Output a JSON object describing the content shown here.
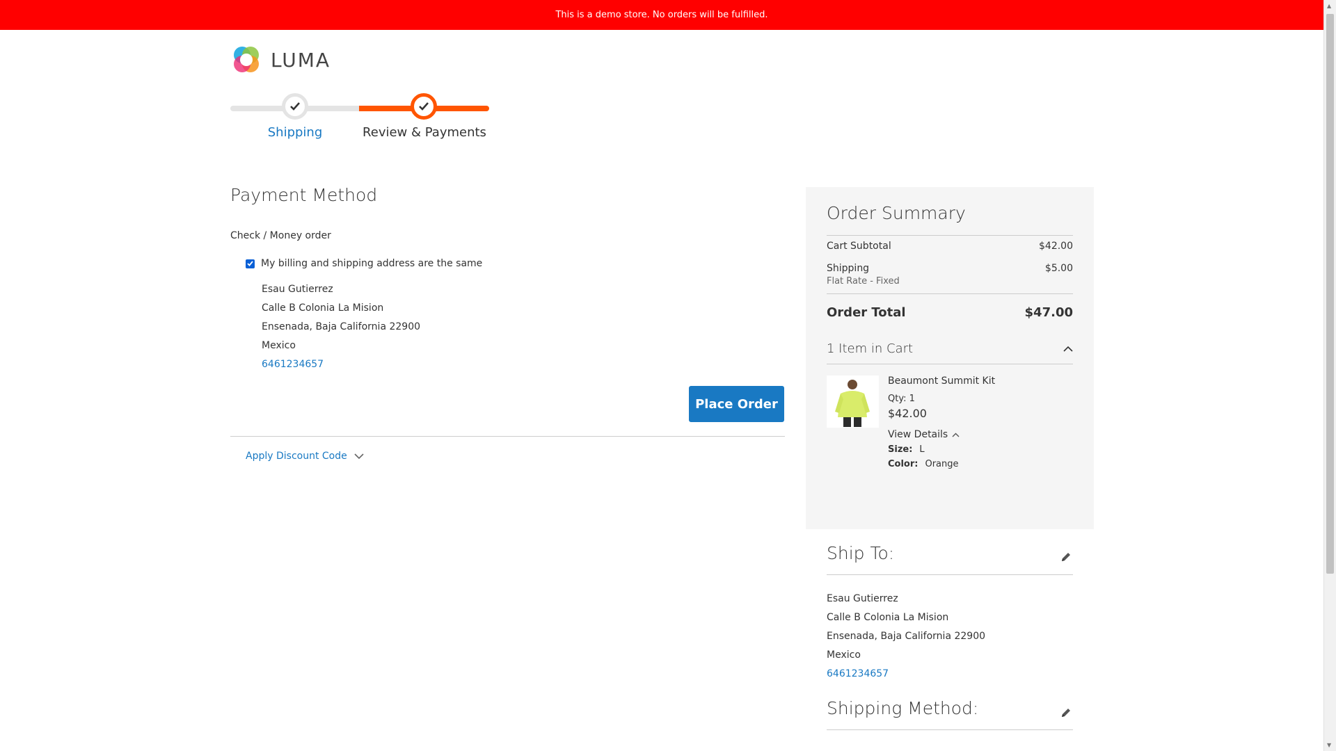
{
  "banner": {
    "text": "This is a demo store. No orders will be fulfilled."
  },
  "logo": {
    "text": "LUMA"
  },
  "progress": {
    "steps": [
      {
        "label": "Shipping",
        "state": "complete"
      },
      {
        "label": "Review & Payments",
        "state": "active"
      }
    ]
  },
  "payment": {
    "title": "Payment Method",
    "option_label": "Check / Money order",
    "same_address_label": "My billing and shipping address are the same",
    "same_address_checked": true,
    "address": {
      "name": "Esau Gutierrez",
      "street": "Calle B Colonia La Mision",
      "city_line": "Ensenada, Baja California 22900",
      "country": "Mexico",
      "phone": "6461234657"
    },
    "place_order_label": "Place Order",
    "discount_label": "Apply Discount Code"
  },
  "summary": {
    "title": "Order Summary",
    "subtotal_label": "Cart Subtotal",
    "subtotal_value": "$42.00",
    "shipping_label": "Shipping",
    "shipping_method": "Flat Rate - Fixed",
    "shipping_value": "$5.00",
    "total_label": "Order Total",
    "total_value": "$47.00",
    "items_title": "1 Item in Cart",
    "item": {
      "name": "Beaumont Summit Kit",
      "qty_label": "Qty:",
      "qty": "1",
      "price": "$42.00",
      "details_label": "View Details",
      "size_label": "Size:",
      "size": "L",
      "color_label": "Color:",
      "color": "Orange"
    }
  },
  "ship_to": {
    "title": "Ship To:",
    "address": {
      "name": "Esau Gutierrez",
      "street": "Calle B Colonia La Mision",
      "city_line": "Ensenada, Baja California 22900",
      "country": "Mexico",
      "phone": "6461234657"
    }
  },
  "shipping_method": {
    "title": "Shipping Method:"
  },
  "colors": {
    "banner": "#ff0000",
    "accent_orange": "#ff5501",
    "primary_blue": "#1979c3",
    "summary_bg": "#f5f5f5"
  },
  "icons": {
    "logo": "luma-logo-icon",
    "step_check": "checkmark-icon",
    "checkbox": "checkbox-checked-icon",
    "discount_toggle": "chevron-down-icon",
    "items_toggle": "chevron-up-icon",
    "details_toggle": "chevron-up-icon",
    "edit": "pencil-icon"
  }
}
